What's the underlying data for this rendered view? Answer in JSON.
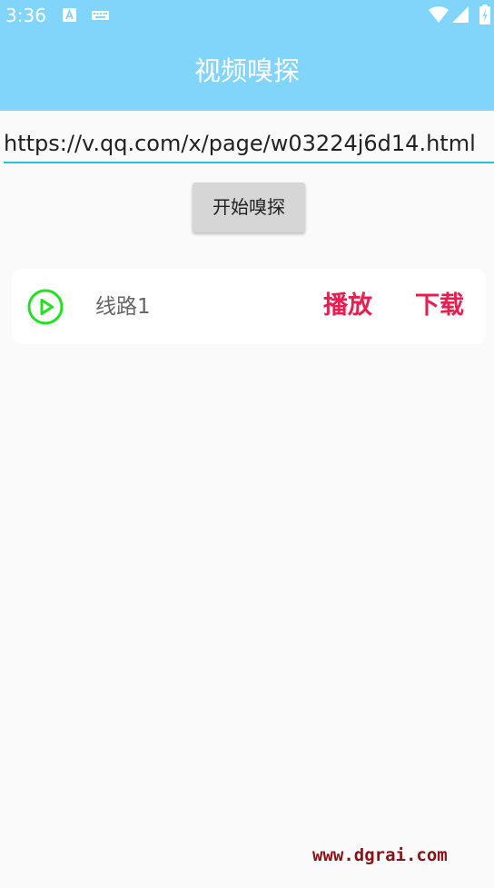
{
  "status_bar": {
    "time": "3:36",
    "icons": [
      "text-a-icon",
      "keyboard-icon",
      "wifi-icon",
      "signal-icon",
      "battery-icon"
    ]
  },
  "app_bar": {
    "title": "视频嗅探"
  },
  "url_input": {
    "value": "https://v.qq.com/x/page/w03224j6d14.html"
  },
  "sniff_button": {
    "label": "开始嗅探"
  },
  "routes": [
    {
      "label": "线路1",
      "play_label": "播放",
      "download_label": "下载"
    }
  ],
  "watermark": "www.dgrai.com",
  "colors": {
    "header": "#81d4fa",
    "accent": "#ec1d4e",
    "play_icon": "#1ee31e",
    "underline": "#26c6da"
  }
}
